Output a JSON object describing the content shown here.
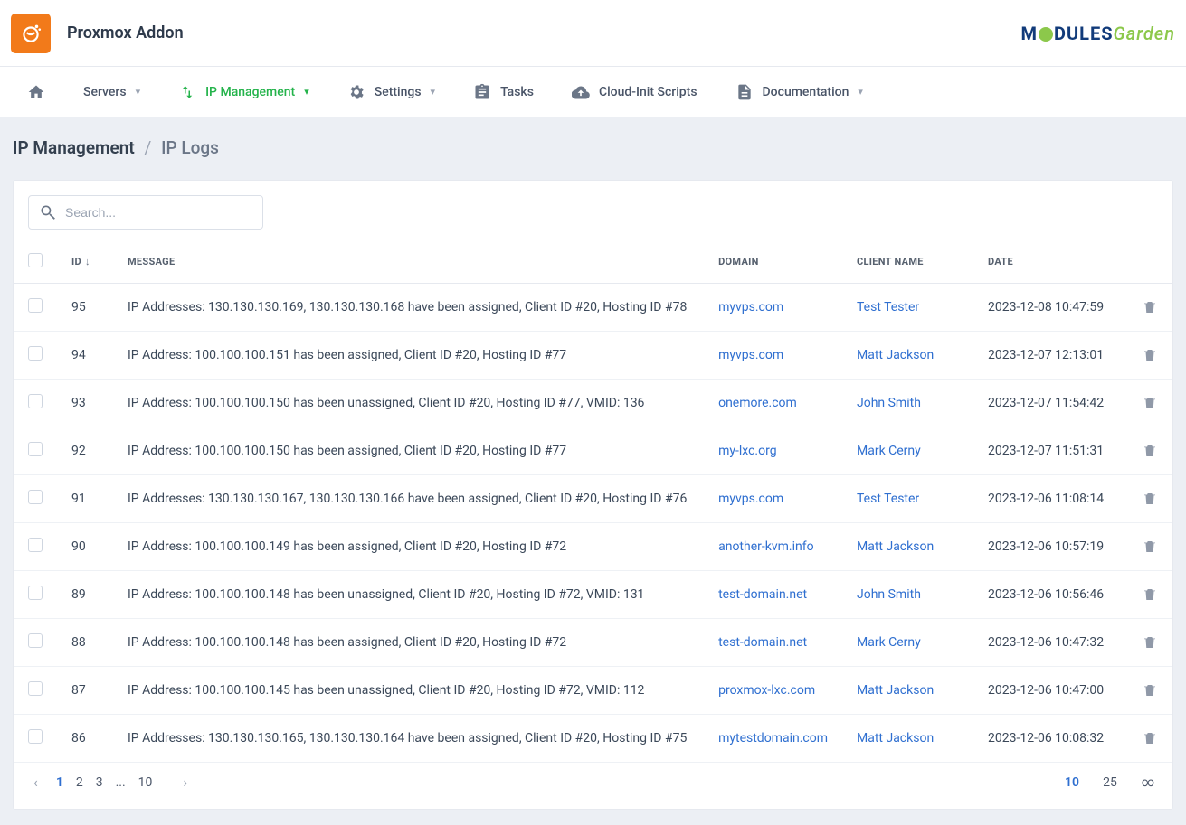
{
  "header": {
    "title": "Proxmox Addon"
  },
  "nav": {
    "servers": "Servers",
    "ip_management": "IP Management",
    "settings": "Settings",
    "tasks": "Tasks",
    "cloud_init": "Cloud-Init Scripts",
    "documentation": "Documentation"
  },
  "breadcrumb": {
    "root": "IP Management",
    "current": "IP Logs"
  },
  "search": {
    "placeholder": "Search..."
  },
  "columns": {
    "id": "ID",
    "message": "MESSAGE",
    "domain": "DOMAIN",
    "client": "CLIENT NAME",
    "date": "DATE"
  },
  "rows": [
    {
      "id": "95",
      "message": "IP Addresses: 130.130.130.169, 130.130.130.168 have been assigned, Client ID #20, Hosting ID #78",
      "domain": "myvps.com",
      "client": "Test Tester",
      "date": "2023-12-08 10:47:59"
    },
    {
      "id": "94",
      "message": "IP Address: 100.100.100.151 has been assigned, Client ID #20, Hosting ID #77",
      "domain": "myvps.com",
      "client": "Matt Jackson",
      "date": "2023-12-07 12:13:01"
    },
    {
      "id": "93",
      "message": "IP Address: 100.100.100.150 has been unassigned, Client ID #20, Hosting ID #77, VMID: 136",
      "domain": "onemore.com",
      "client": "John Smith",
      "date": "2023-12-07 11:54:42"
    },
    {
      "id": "92",
      "message": "IP Address: 100.100.100.150 has been assigned, Client ID #20, Hosting ID #77",
      "domain": "my-lxc.org",
      "client": "Mark Cerny",
      "date": "2023-12-07 11:51:31"
    },
    {
      "id": "91",
      "message": "IP Addresses: 130.130.130.167, 130.130.130.166 have been assigned, Client ID #20, Hosting ID #76",
      "domain": "myvps.com",
      "client": "Test Tester",
      "date": "2023-12-06 11:08:14"
    },
    {
      "id": "90",
      "message": "IP Address: 100.100.100.149 has been assigned, Client ID #20, Hosting ID #72",
      "domain": "another-kvm.info",
      "client": "Matt Jackson",
      "date": "2023-12-06 10:57:19"
    },
    {
      "id": "89",
      "message": "IP Address: 100.100.100.148 has been unassigned, Client ID #20, Hosting ID #72, VMID: 131",
      "domain": "test-domain.net",
      "client": "John Smith",
      "date": "2023-12-06 10:56:46"
    },
    {
      "id": "88",
      "message": "IP Address: 100.100.100.148 has been assigned, Client ID #20, Hosting ID #72",
      "domain": "test-domain.net",
      "client": "Mark Cerny",
      "date": "2023-12-06 10:47:32"
    },
    {
      "id": "87",
      "message": "IP Address: 100.100.100.145 has been unassigned, Client ID #20, Hosting ID #72, VMID: 112",
      "domain": "proxmox-lxc.com",
      "client": "Matt Jackson",
      "date": "2023-12-06 10:47:00"
    },
    {
      "id": "86",
      "message": "IP Addresses: 130.130.130.165, 130.130.130.164 have been assigned, Client ID #20, Hosting ID #75",
      "domain": "mytestdomain.com",
      "client": "Matt Jackson",
      "date": "2023-12-06 10:08:32"
    }
  ],
  "pagination": {
    "pages": [
      "1",
      "2",
      "3",
      "...",
      "10"
    ],
    "active": "1",
    "size_active": "10",
    "size_alt": "25",
    "size_inf": "∞"
  }
}
